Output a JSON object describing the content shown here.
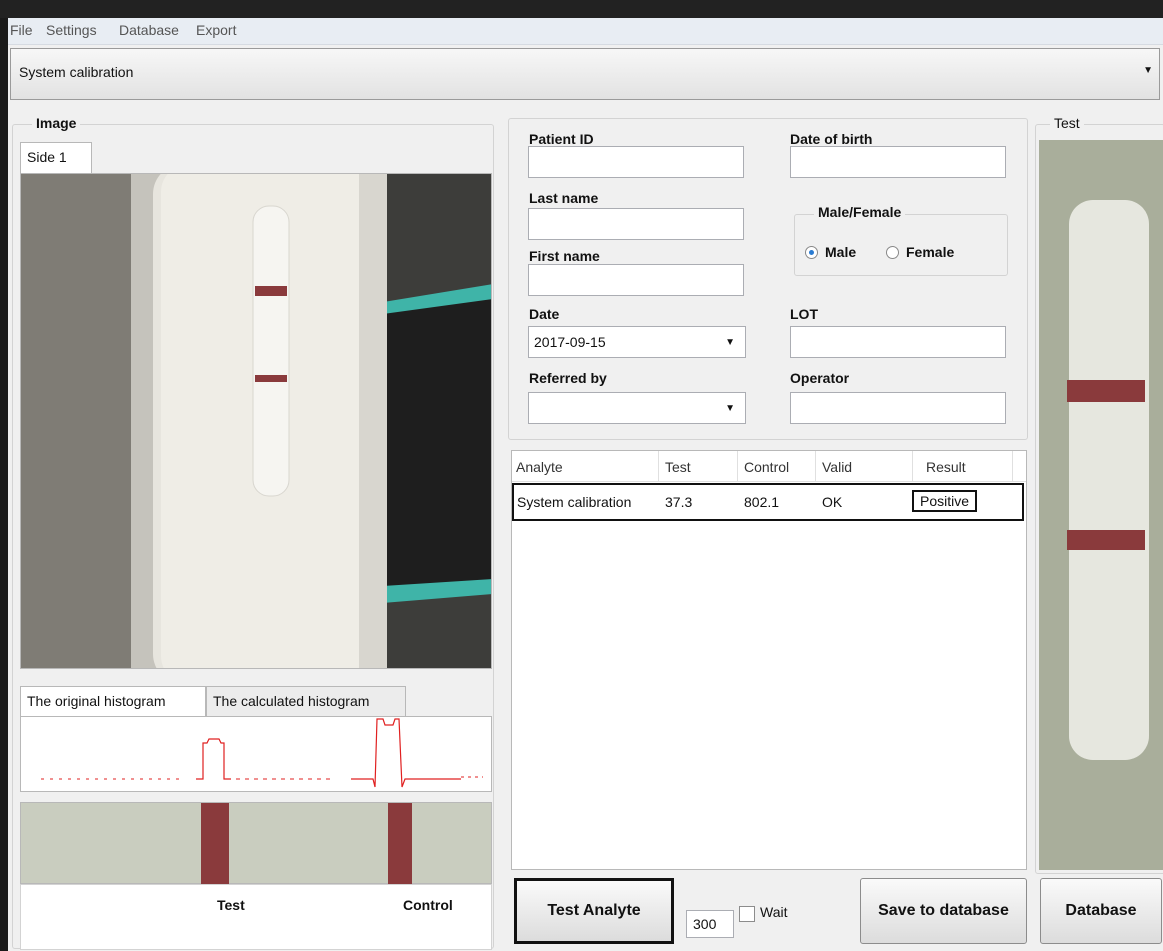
{
  "menu": [
    "File",
    "Settings",
    "Database",
    "Export"
  ],
  "analyte_selector": {
    "value": "System calibration"
  },
  "image_group": {
    "legend": "Image",
    "tab": "Side 1",
    "histogram_tabs": [
      "The original histogram",
      "The calculated histogram"
    ],
    "strip_labels": {
      "test": "Test",
      "control": "Control"
    }
  },
  "patient": {
    "patient_id_label": "Patient ID",
    "dob_label": "Date of birth",
    "last_name_label": "Last name",
    "first_name_label": "First name",
    "gender_group": "Male/Female",
    "male_label": "Male",
    "female_label": "Female",
    "gender_selected": "Male",
    "date_label": "Date",
    "date_value": "2017-09-15",
    "lot_label": "LOT",
    "referred_label": "Referred by",
    "operator_label": "Operator"
  },
  "results_table": {
    "columns": [
      "Analyte",
      "Test",
      "Control",
      "Valid",
      "Result"
    ],
    "rows": [
      {
        "analyte": "System calibration",
        "test": "37.3",
        "control": "802.1",
        "valid": "OK",
        "result": "Positive"
      }
    ]
  },
  "actions": {
    "test_analyte": "Test Analyte",
    "count_value": "300",
    "wait_label": "Wait",
    "save_db": "Save to  database",
    "database": "Database"
  },
  "test_group": {
    "legend": "Test"
  },
  "colors": {
    "band": "#8a3a3c",
    "accent": "#2a7bd1",
    "histogram": "#e02020"
  }
}
